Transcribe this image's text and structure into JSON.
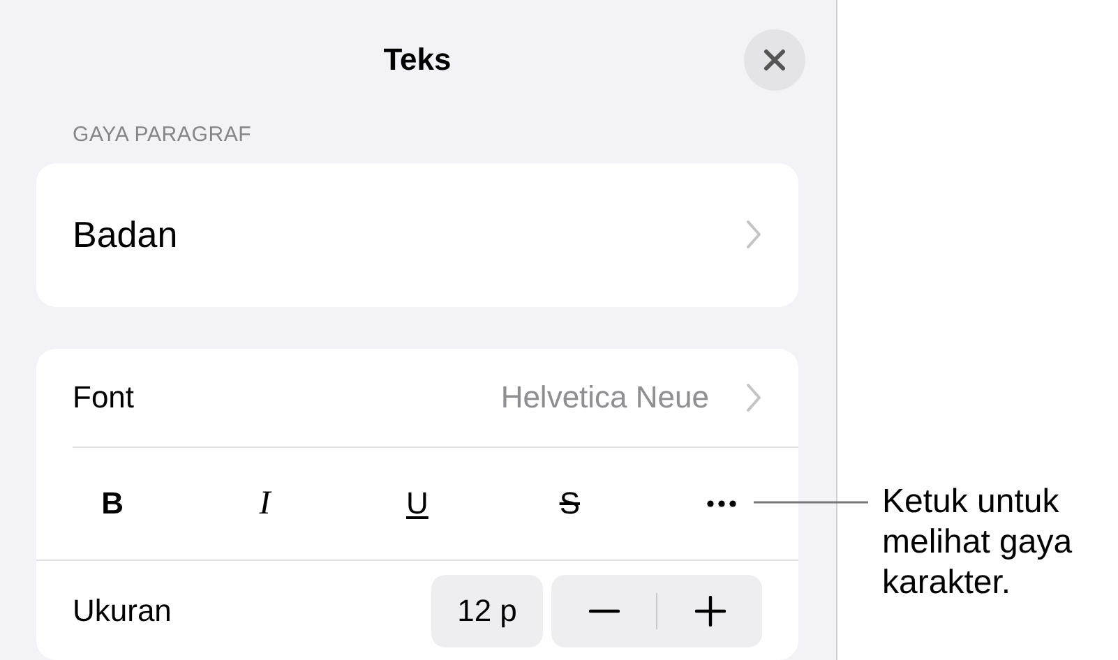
{
  "panel": {
    "title": "Teks",
    "section_label": "GAYA PARAGRAF",
    "paragraph_style": "Badan",
    "font": {
      "label": "Font",
      "value": "Helvetica Neue"
    },
    "style_buttons": [
      {
        "kind": "bold",
        "label": "B"
      },
      {
        "kind": "italic",
        "label": "I"
      },
      {
        "kind": "underline",
        "label": "U"
      },
      {
        "kind": "strikethrough",
        "label": "S"
      },
      {
        "kind": "more"
      }
    ],
    "size": {
      "label": "Ukuran",
      "value": "12 p"
    }
  },
  "callout": {
    "text": "Ketuk untuk melihat gaya karakter."
  }
}
